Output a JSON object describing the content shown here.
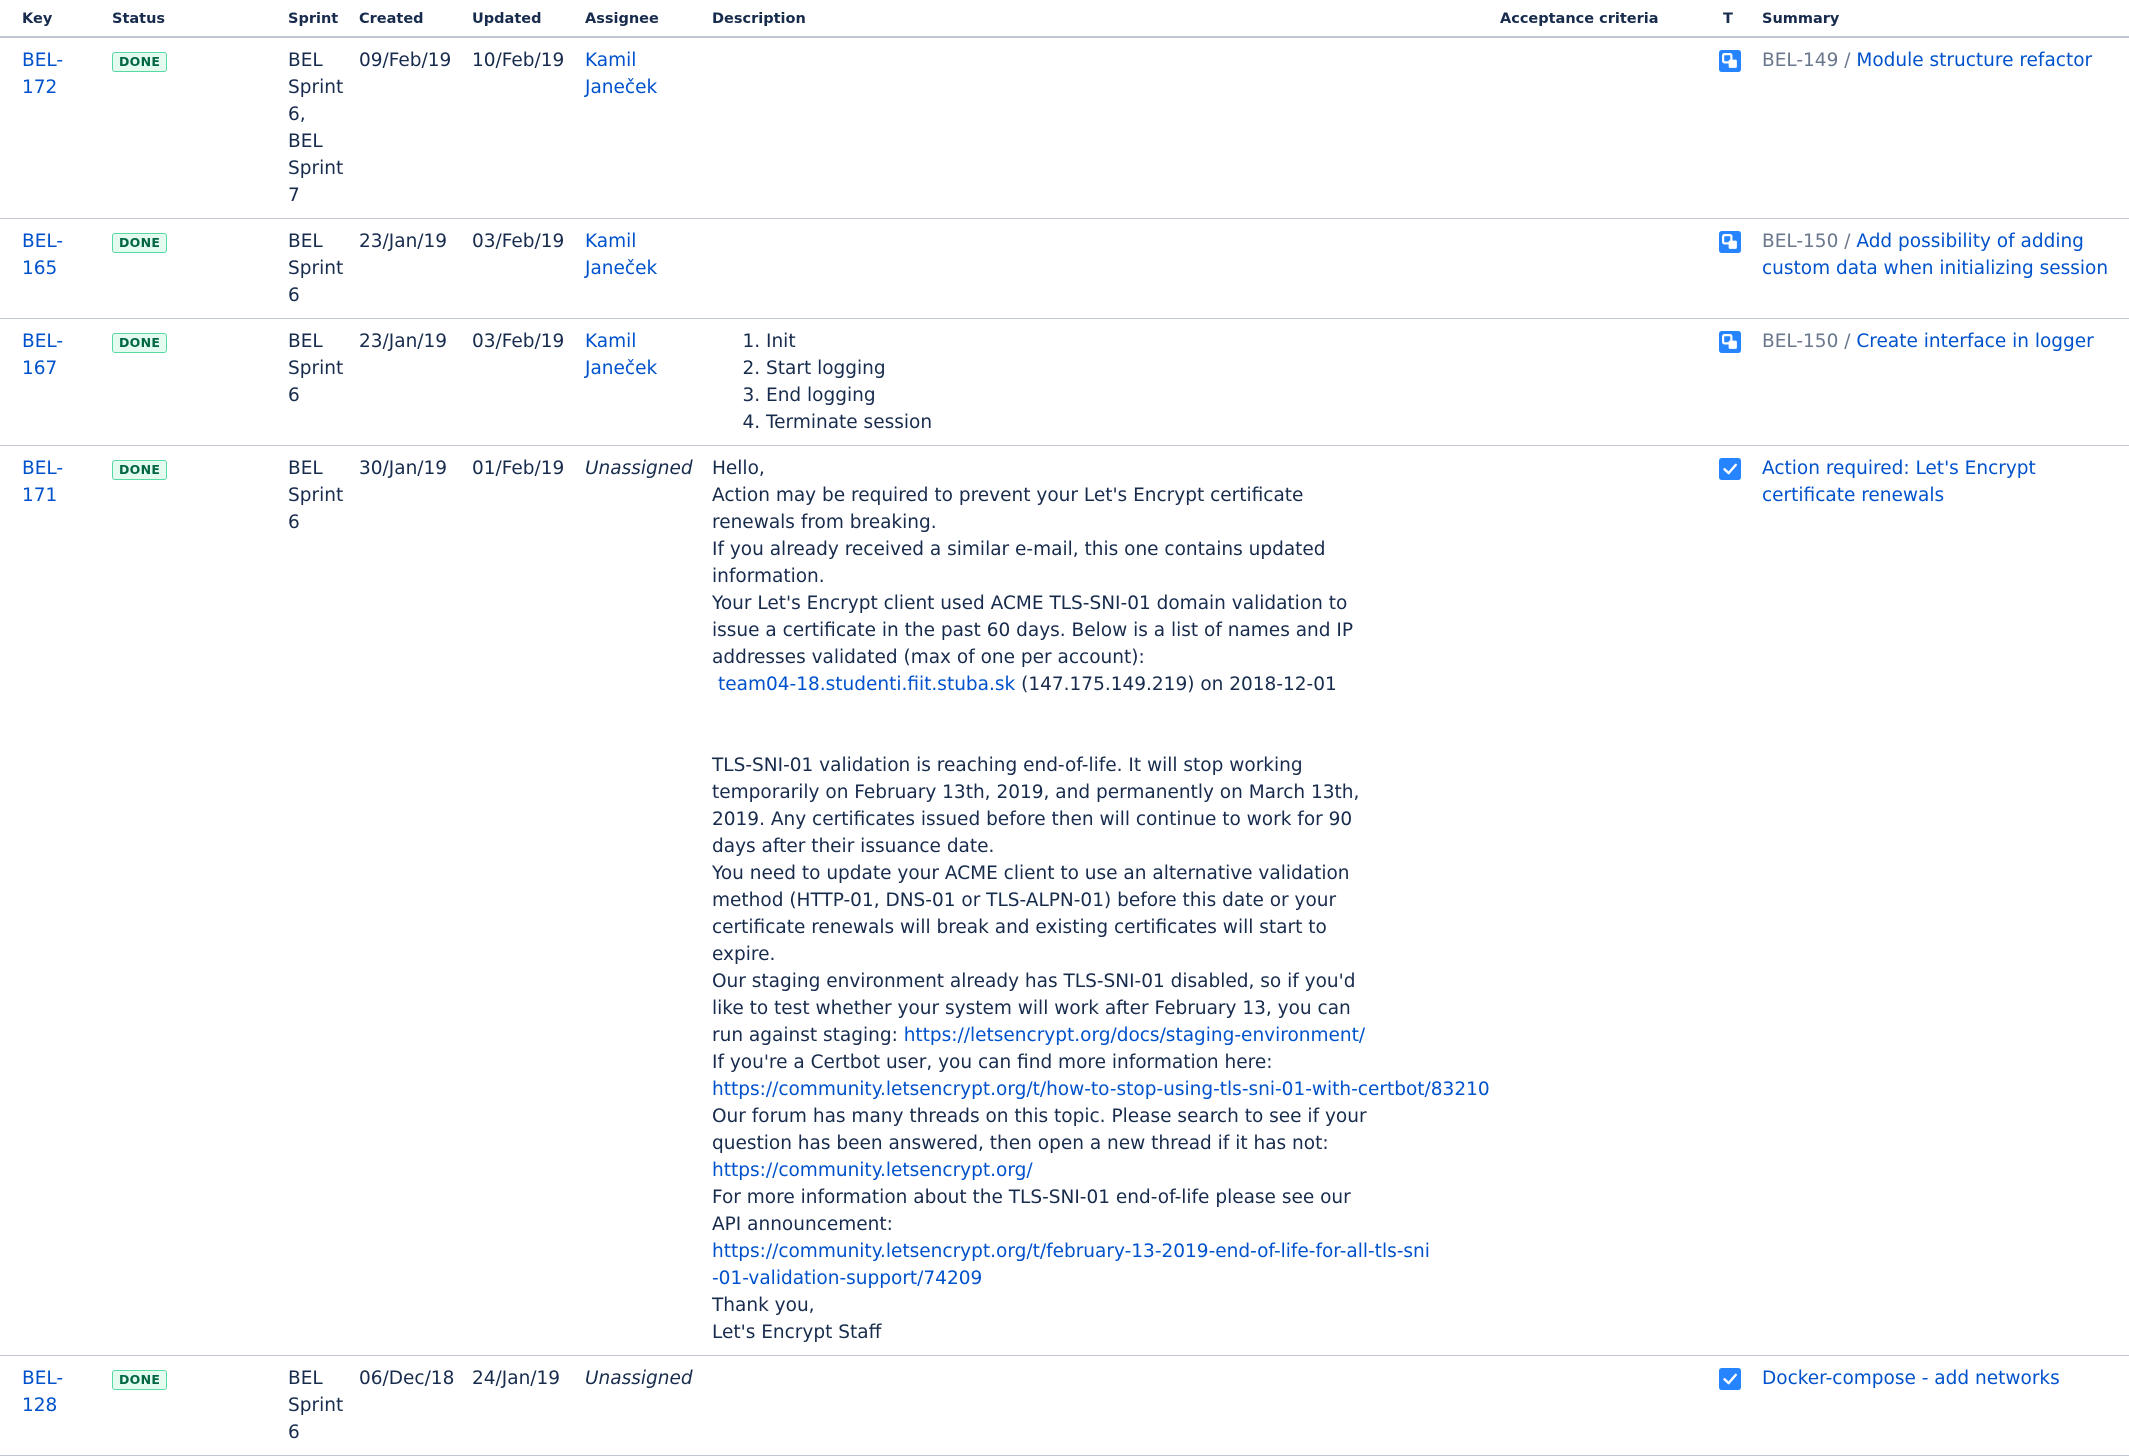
{
  "columns": {
    "key": "Key",
    "status": "Status",
    "sprint": "Sprint",
    "created": "Created",
    "updated": "Updated",
    "assignee": "Assignee",
    "description": "Description",
    "acceptance": "Acceptance criteria",
    "type": "T",
    "summary": "Summary"
  },
  "colors": {
    "link": "#0052cc",
    "done_green": "#006644",
    "done_border": "#57d9a3",
    "subtask_blue": "#2684ff",
    "divider": "#c1c7d0"
  },
  "rows": [
    {
      "key": "BEL-172",
      "status": "DONE",
      "sprint": "BEL Sprint 6, BEL Sprint 7",
      "created": "09/Feb/19",
      "updated": "10/Feb/19",
      "assignee": "Kamil Janeček",
      "type_icon": "subtask-icon",
      "parent": "BEL-149 /",
      "summary": "Module structure refactor"
    },
    {
      "key": "BEL-165",
      "status": "DONE",
      "sprint": "BEL Sprint 6",
      "created": "23/Jan/19",
      "updated": "03/Feb/19",
      "assignee": "Kamil Janeček",
      "type_icon": "subtask-icon",
      "parent": "BEL-150 /",
      "summary": "Add possibility of adding custom data when initializing session"
    },
    {
      "key": "BEL-167",
      "status": "DONE",
      "sprint": "BEL Sprint 6",
      "created": "23/Jan/19",
      "updated": "03/Feb/19",
      "assignee": "Kamil Janeček",
      "description_list": [
        "Init",
        "Start logging",
        "End logging",
        "Terminate session"
      ],
      "type_icon": "subtask-icon",
      "parent": "BEL-150 /",
      "summary": "Create interface in logger"
    },
    {
      "key": "BEL-171",
      "status": "DONE",
      "sprint": "BEL Sprint 6",
      "created": "30/Jan/19",
      "updated": "01/Feb/19",
      "assignee": "Unassigned",
      "description": {
        "hello": "Hello,",
        "p1": "Action may be required to prevent your Let's Encrypt certificate renewals from breaking.",
        "p2": "If you already received a similar e-mail, this one contains updated information.",
        "p3": "Your Let's Encrypt client used ACME TLS-SNI-01 domain validation to issue a certificate in the past 60 days. Below is a list of names and IP addresses validated (max of one per account):",
        "host_link": "team04-18.studenti.fiit.stuba.sk",
        "host_rest": " (147.175.149.219) on 2018-12-01",
        "p4": "TLS-SNI-01 validation is reaching end-of-life. It will stop working temporarily on February 13th, 2019, and permanently on March 13th, 2019. Any certificates issued before then will continue to work for 90 days after their issuance date.",
        "p5": "You need to update your ACME client to use an alternative validation method (HTTP-01, DNS-01 or TLS-ALPN-01) before this date or your certificate renewals will break and existing certificates will start to expire.",
        "p6": "Our staging environment already has TLS-SNI-01 disabled, so if you'd like to test whether your system will work after February 13, you can run against staging: ",
        "staging_link": "https://letsencrypt.org/docs/staging-environment/",
        "p7": "If you're a Certbot user, you can find more information here:",
        "certbot_link": "https://community.letsencrypt.org/t/how-to-stop-using-tls-sni-01-with-certbot/83210",
        "p8": "Our forum has many threads on this topic. Please search to see if your question has been answered, then open a new thread if it has not:",
        "forum_link": "https://community.letsencrypt.org/",
        "p9": "For more information about the TLS-SNI-01 end-of-life please see our API announcement:",
        "announce_link": "https://community.letsencrypt.org/t/february-13-2019-end-of-life-for-all-tls-sni-01-validation-support/74209",
        "thanks": "Thank you,",
        "staff": "Let's Encrypt Staff"
      },
      "type_icon": "task-checkbox-icon",
      "summary": "Action required: Let's Encrypt certificate renewals"
    },
    {
      "key": "BEL-128",
      "status": "DONE",
      "sprint": "BEL Sprint 6",
      "created": "06/Dec/18",
      "updated": "24/Jan/19",
      "assignee": "Unassigned",
      "type_icon": "task-checkbox-icon",
      "summary": "Docker-compose - add networks"
    }
  ]
}
